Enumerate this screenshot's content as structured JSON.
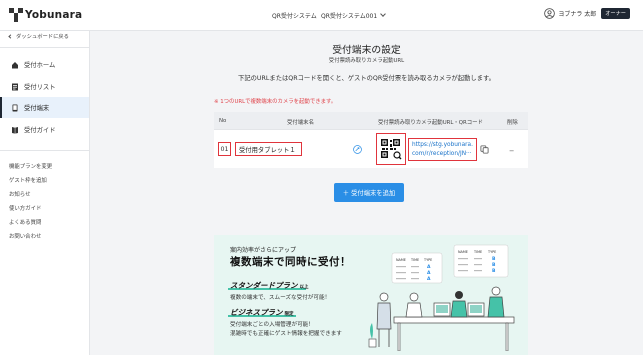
{
  "header": {
    "logo_text": "Yobunara",
    "nav_reception_system": "QR受付システム",
    "nav_system_select": "QR受付システム001",
    "user_name": "ヨブナラ 太郎",
    "owner_badge": "オーナー"
  },
  "sidebar": {
    "back_label": "ダッシュボードに戻る",
    "items": [
      {
        "label": "受付ホーム",
        "icon": "home-icon",
        "active": false
      },
      {
        "label": "受付リスト",
        "icon": "list-icon",
        "active": false
      },
      {
        "label": "受付端末",
        "icon": "terminal-icon",
        "active": true
      },
      {
        "label": "受付ガイド",
        "icon": "guide-icon",
        "active": false
      }
    ],
    "links": [
      "機能プランを変更",
      "ゲスト枠を追加",
      "お知らせ",
      "使い方ガイド",
      "よくある質問",
      "お問い合わせ"
    ]
  },
  "main": {
    "title": "受付端末の設定",
    "subtitle": "受付票読み取りカメラ起動URL",
    "description": "下記のURLまたはQRコードを開くと、ゲストのQR受付票を読み取るカメラが起動します。",
    "warning": "※ 1つのURLで複数端末のカメラを起動できます。"
  },
  "table": {
    "headers": {
      "no": "No",
      "name": "受付端末名",
      "url": "受付票読み取りカメラ起動URL・QRコード",
      "delete": "削除"
    },
    "rows": [
      {
        "no": "01",
        "name": "受付用タブレット１",
        "url_line1": "https://stg.yobunara.",
        "url_line2": "com/r/reception/JN···",
        "delete": "−"
      }
    ]
  },
  "add_button_label": "＋ 受付端末を追加",
  "banner": {
    "kicker": "案内効率がさらにアップ",
    "title": "複数端末で同時に受付！",
    "standard_plan": "スタンダードプラン",
    "standard_tag": "以上",
    "standard_text": "複数の端末で、スムーズな受付が可能！",
    "business_plan": "ビジネスプラン",
    "business_tag": "限定",
    "business_text_1": "受付端末ごとの入場管理が可能！",
    "business_text_2": "混雑時でも正確にゲスト情報を把握できます",
    "card_headers": [
      "NAME",
      "TIME",
      "TYPE"
    ],
    "card_types_a": [
      "A",
      "A",
      "A"
    ],
    "card_types_b": [
      "B",
      "B",
      "B"
    ]
  },
  "colors": {
    "accent": "#2a8ee6",
    "warning": "#e0434a",
    "banner_bg": "#e7f6f2",
    "teal": "#45c2a8"
  }
}
